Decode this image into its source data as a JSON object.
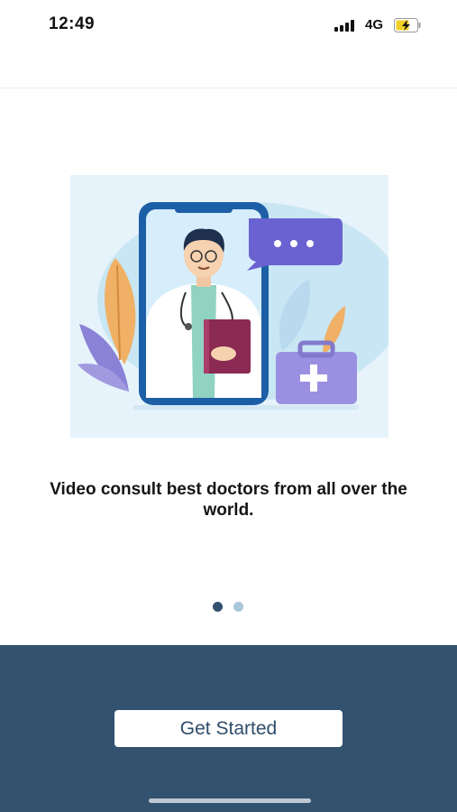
{
  "status_bar": {
    "time": "12:49",
    "network": "4G",
    "battery_icon": "battery-charging-icon",
    "signal_icon": "signal-bars-icon"
  },
  "onboarding": {
    "illustration_icon": "doctor-video-call-illustration",
    "caption": "Video consult best doctors from all over the world.",
    "pagination": {
      "total": 2,
      "active_index": 0
    }
  },
  "footer": {
    "get_started_label": "Get Started"
  },
  "colors": {
    "footer_bg": "#33526f",
    "accent": "#2f4c6b",
    "dot_active": "#33506f",
    "dot_inactive": "#a8c7da"
  }
}
